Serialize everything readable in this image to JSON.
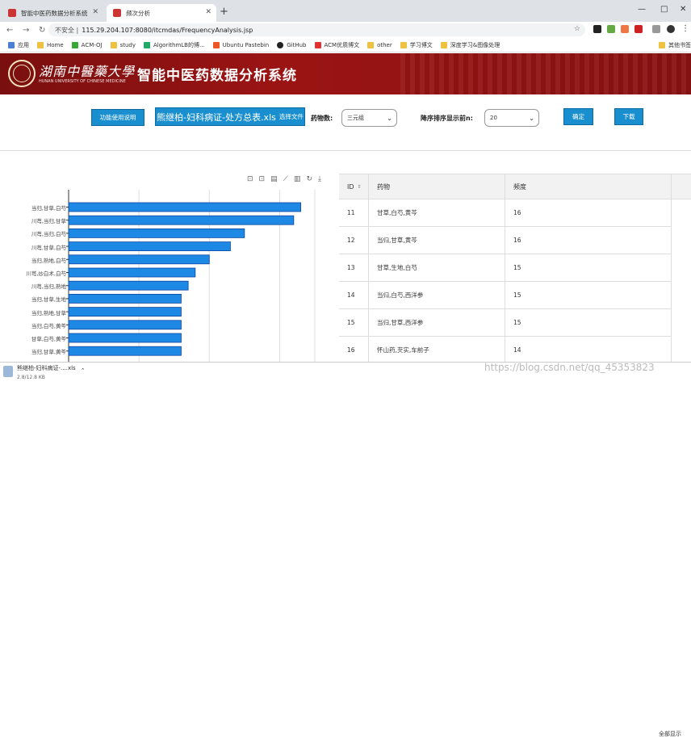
{
  "browser": {
    "tabs": [
      {
        "title": "智能中医药数据分析系统"
      },
      {
        "title": "频次分析"
      }
    ],
    "url_prefix": "不安全 | ",
    "url": "115.29.204.107:8080/itcmdas/FrequencyAnalysis.jsp",
    "bookmarks": [
      "应用",
      "Home",
      "ACM-OJ",
      "study",
      "AlgorithmLB的博...",
      "Ubuntu Pastebin",
      "GitHub",
      "ACM优质博文",
      "other",
      "学习博文",
      "深度学习&图像处理",
      "其他书签"
    ]
  },
  "banner": {
    "university": "湖南中醫藥大學",
    "university_en": "HUNAN UNIVERSITY OF CHINESE MEDICINE",
    "system_title": "智能中医药数据分析系统"
  },
  "controls": {
    "help_button": "功能使用说明",
    "file_name": "熊继柏-妇科病证-处方总表.xls",
    "choose_file": "选择文件",
    "drug_count_label": "药物数:",
    "drug_count_value": "三元组",
    "topn_label": "降序排序显示前n:",
    "topn_value": "20",
    "confirm_button": "确定",
    "download_button": "下载"
  },
  "chart_data": {
    "type": "bar",
    "orientation": "horizontal",
    "categories": [
      "当归,甘草,白芍",
      "川芎,当归,甘草",
      "川芎,当归,白芍",
      "川芎,甘草,白芍",
      "当归,熟地,白芍",
      "川芎,炒白术,白芍",
      "川芎,当归,熟地",
      "当归,甘草,生地",
      "当归,熟地,甘草",
      "当归,白芍,黄芩",
      "甘草,白芍,黄芩",
      "当归,甘草,黄芩"
    ],
    "values": [
      33,
      32,
      25,
      23,
      20,
      18,
      17,
      16,
      16,
      16,
      16,
      16
    ],
    "xlim": [
      0,
      35
    ],
    "grid": true,
    "color": "#1e88e5"
  },
  "table": {
    "headers": [
      "ID",
      "药物",
      "频度"
    ],
    "rows": [
      {
        "id": "11",
        "drugs": "甘草,白芍,黄芩",
        "freq": "16"
      },
      {
        "id": "12",
        "drugs": "当归,甘草,黄芩",
        "freq": "16"
      },
      {
        "id": "13",
        "drugs": "甘草,生地,白芍",
        "freq": "15"
      },
      {
        "id": "14",
        "drugs": "当归,白芍,西洋参",
        "freq": "15"
      },
      {
        "id": "15",
        "drugs": "当归,甘草,西洋参",
        "freq": "15"
      },
      {
        "id": "16",
        "drugs": "怀山药,芡实,车前子",
        "freq": "14"
      }
    ]
  },
  "downloads": {
    "file": "熊继柏-妇科病证-....xls",
    "size": "2.8/12.8 KB",
    "show_all": "全部显示"
  },
  "watermark": "https://blog.csdn.net/qq_45353823"
}
